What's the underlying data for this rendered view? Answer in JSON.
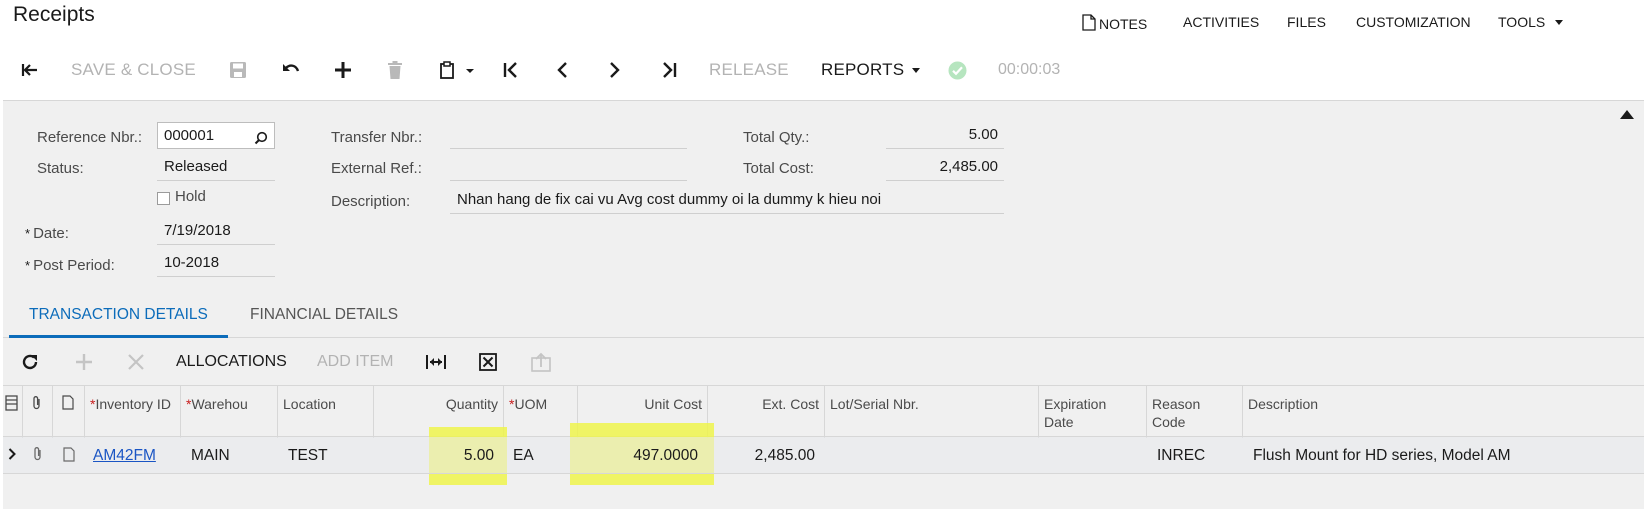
{
  "page": {
    "title": "Receipts"
  },
  "top_menu": {
    "notes": "NOTES",
    "activities": "ACTIVITIES",
    "files": "FILES",
    "customization": "CUSTOMIZATION",
    "tools": "TOOLS"
  },
  "toolbar": {
    "save_close": "SAVE & CLOSE",
    "release": "RELEASE",
    "reports": "REPORTS",
    "timer": "00:00:03"
  },
  "form": {
    "reference_nbr": {
      "label": "Reference Nbr.:",
      "value": "000001"
    },
    "status": {
      "label": "Status:",
      "value": "Released"
    },
    "hold": {
      "label": "Hold",
      "checked": false
    },
    "date": {
      "label": "Date:",
      "value": "7/19/2018"
    },
    "post_period": {
      "label": "Post Period:",
      "value": "10-2018"
    },
    "transfer_nbr": {
      "label": "Transfer Nbr.:",
      "value": ""
    },
    "external_ref": {
      "label": "External Ref.:",
      "value": ""
    },
    "description": {
      "label": "Description:",
      "value": "Nhan hang de fix cai vu Avg cost dummy oi la dummy k hieu noi"
    },
    "total_qty": {
      "label": "Total Qty.:",
      "value": "5.00"
    },
    "total_cost": {
      "label": "Total Cost:",
      "value": "2,485.00"
    },
    "required_marker": "*"
  },
  "tabs": [
    {
      "label": "TRANSACTION DETAILS",
      "active": true
    },
    {
      "label": "FINANCIAL DETAILS",
      "active": false
    }
  ],
  "grid_toolbar": {
    "allocations": "ALLOCATIONS",
    "add_item": "ADD ITEM"
  },
  "grid": {
    "columns": {
      "inventory_id": "Inventory ID",
      "warehouse": "Warehou",
      "location": "Location",
      "quantity": "Quantity",
      "uom": "UOM",
      "unit_cost": "Unit Cost",
      "ext_cost": "Ext. Cost",
      "lot_serial": "Lot/Serial Nbr.",
      "expiration_date": "Expiration Date",
      "reason_code": "Reason Code",
      "description": "Description"
    },
    "rows": [
      {
        "inventory_id": "AM42FM",
        "warehouse": "MAIN",
        "location": "TEST",
        "quantity": "5.00",
        "uom": "EA",
        "unit_cost": "497.0000",
        "ext_cost": "2,485.00",
        "lot_serial": "",
        "expiration_date": "",
        "reason_code": "INREC",
        "description": "Flush Mount for HD series, Model AM"
      }
    ]
  },
  "colors": {
    "accent": "#0c6cba",
    "link": "#1a55c4",
    "highlight": "#eef54c",
    "required_star": "#c81e1e",
    "status_ok": "#5cc46f"
  }
}
